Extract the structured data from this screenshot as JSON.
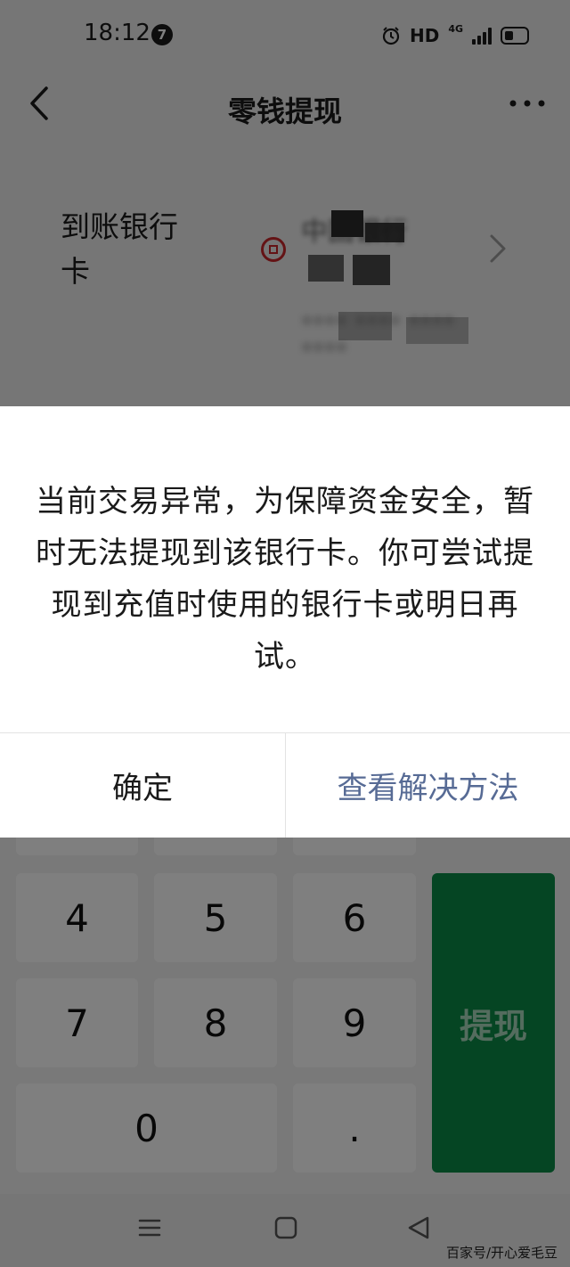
{
  "status_bar": {
    "time": "18:12",
    "notification_count": "7",
    "hd": "HD",
    "network": "4G",
    "alarm_icon": "alarm-clock-icon",
    "battery_icon": "battery-icon"
  },
  "nav": {
    "title": "零钱提现",
    "back_icon": "chevron-left-icon",
    "more_icon": "more-dots-icon"
  },
  "card": {
    "label": "到账银行卡",
    "bank_name": "中国银行",
    "card_type": "储蓄卡",
    "card_number": "**** **** **** ****",
    "logo_color": "#c8262b"
  },
  "dialog": {
    "message": "当前交易异常，为保障资金安全，暂时无法提现到该银行卡。你可尝试提现到充值时使用的银行卡或明日再试。",
    "confirm_label": "确定",
    "solution_label": "查看解决方法",
    "link_color": "#576b95"
  },
  "keypad": {
    "keys": [
      "4",
      "5",
      "6",
      "7",
      "8",
      "9",
      "0",
      "."
    ],
    "submit_label": "提现",
    "submit_color": "#0a8a47"
  },
  "watermark": "百家号/开心爱毛豆"
}
